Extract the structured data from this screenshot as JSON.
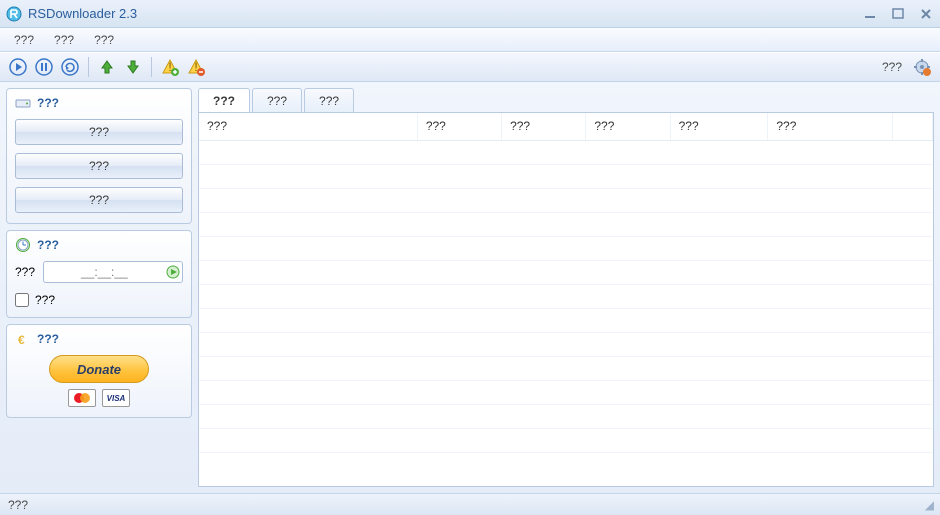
{
  "window": {
    "title": "RSDownloader 2.3"
  },
  "menubar": {
    "items": [
      "???",
      "???",
      "???"
    ]
  },
  "toolbar": {
    "right_label": "???"
  },
  "sidebar": {
    "panel1": {
      "title": "???",
      "buttons": [
        "???",
        "???",
        "???"
      ]
    },
    "panel2": {
      "title": "???",
      "time_label": "???",
      "time_value": "__:__:__",
      "check_label": "???"
    },
    "panel3": {
      "title": "???",
      "donate_label": "Donate",
      "visa_label": "VISA"
    }
  },
  "tabs": [
    "???",
    "???",
    "???"
  ],
  "table": {
    "columns": [
      "???",
      "???",
      "???",
      "???",
      "???",
      "???",
      ""
    ]
  },
  "statusbar": {
    "text": "???"
  }
}
